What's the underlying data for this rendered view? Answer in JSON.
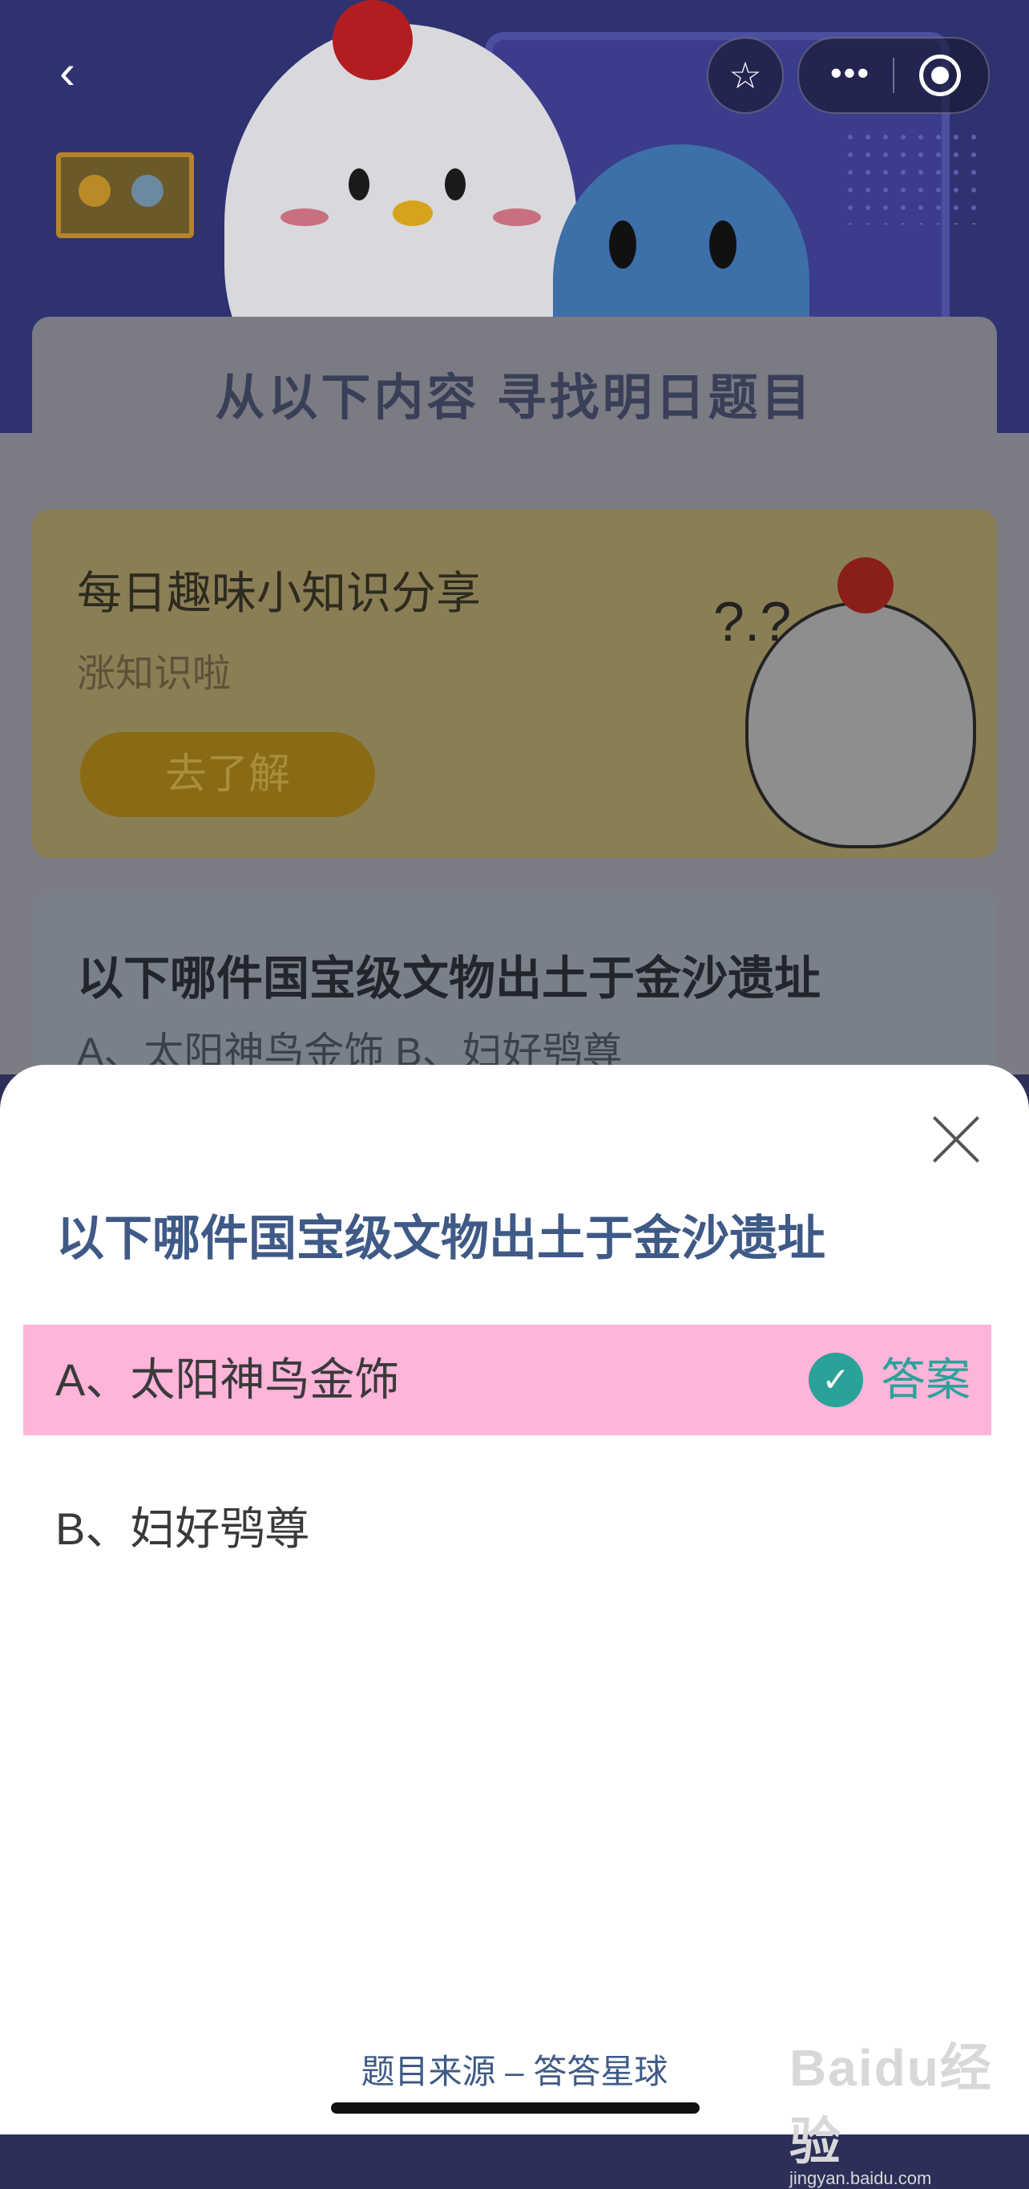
{
  "top_bar": {
    "back_icon": "chevron-left-icon",
    "back_glyph": "‹",
    "star_icon": "star-icon",
    "star_glyph": "☆",
    "more_icon": "more-dots-icon",
    "more_glyph": "•••",
    "target_icon": "target-icon"
  },
  "banner": {
    "title": "从以下内容 寻找明日题目"
  },
  "share_card": {
    "title": "每日趣味小知识分享",
    "subtitle": "涨知识啦",
    "button_label": "去了解",
    "question_marks": "?.?",
    "accent": "#f5b800"
  },
  "quiz_card": {
    "question": "以下哪件国宝级文物出土于金沙遗址",
    "options_line": "A、太阳神鸟金饰    B、妇好鸮尊"
  },
  "sheet": {
    "close_icon": "close-icon",
    "question": "以下哪件国宝级文物出土于金沙遗址",
    "options": [
      {
        "label": "A、太阳神鸟金饰",
        "is_answer": true,
        "answer_tag": "答案",
        "check_glyph": "✓"
      },
      {
        "label": "B、妇好鸮尊",
        "is_answer": false
      }
    ],
    "highlight_color": "#ffb4d9",
    "answer_color": "#2aa29a",
    "source": "题目来源 – 答答星球",
    "watermark": "Baidu经验",
    "watermark_sub": "jingyan.baidu.com"
  }
}
